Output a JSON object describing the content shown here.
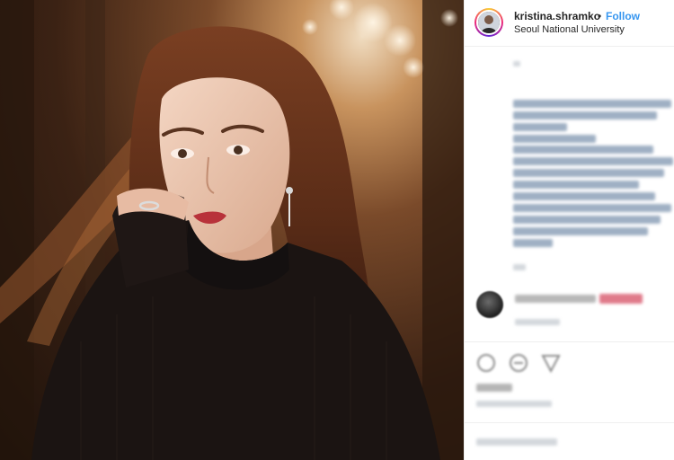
{
  "post": {
    "username": "kristina.shramko",
    "separator": "•",
    "follow_label": "Follow",
    "location": "Seoul National University"
  },
  "icons": {
    "like": "heart-icon",
    "comment": "comment-icon",
    "share": "share-icon"
  },
  "colors": {
    "link_blue": "#3897f0",
    "text": "#262626",
    "border": "#efefef"
  }
}
